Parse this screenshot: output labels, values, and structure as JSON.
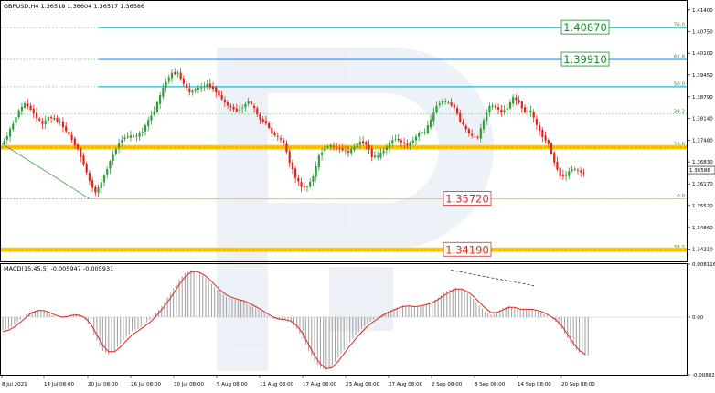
{
  "header": {
    "price_title": "GBPUSD,H4  1.36518 1.36604 1.36517 1.36586",
    "macd_title": "MACD(15,45,5) -0.005947 -0.005931"
  },
  "chart_data": [
    {
      "type": "candlestick",
      "symbol": "GBPUSD",
      "timeframe": "H4",
      "ohlc_last": [
        1.36518,
        1.36604,
        1.36517,
        1.36586
      ],
      "ylim": [
        1.3384,
        1.4167
      ],
      "y_ticks": [
        "1.41400",
        "1.40750",
        "1.40100",
        "1.39450",
        "1.38790",
        "1.38140",
        "1.37480",
        "1.36830",
        "1.36170",
        "1.35520",
        "1.34860",
        "1.34210"
      ],
      "x_ticks": [
        "8 Jul 2021",
        "14 Jul 08:00",
        "20 Jul 08:00",
        "26 Jul 08:00",
        "30 Jul 08:00",
        "5 Aug 08:00",
        "11 Aug 08:00",
        "17 Aug 08:00",
        "23 Aug 08:00",
        "27 Aug 08:00",
        "2 Sep 08:00",
        "8 Sep 08:00",
        "14 Sep 08:00",
        "20 Sep 08:00"
      ],
      "current_price": "1.36586",
      "close_path": [
        1.3735,
        1.3762,
        1.3798,
        1.3838,
        1.3858,
        1.3842,
        1.3816,
        1.3797,
        1.3818,
        1.3812,
        1.3802,
        1.3776,
        1.375,
        1.3721,
        1.3678,
        1.3625,
        1.3591,
        1.3621,
        1.3664,
        1.3705,
        1.3741,
        1.3758,
        1.376,
        1.3761,
        1.3776,
        1.3808,
        1.3837,
        1.3882,
        1.3925,
        1.3949,
        1.395,
        1.3918,
        1.3892,
        1.3902,
        1.3907,
        1.3915,
        1.3904,
        1.3884,
        1.386,
        1.3848,
        1.3836,
        1.3848,
        1.3866,
        1.3843,
        1.381,
        1.38,
        1.3768,
        1.3757,
        1.374,
        1.3683,
        1.3637,
        1.3608,
        1.3608,
        1.3639,
        1.37,
        1.3726,
        1.3733,
        1.3725,
        1.3719,
        1.3712,
        1.3728,
        1.3743,
        1.3737,
        1.37,
        1.3699,
        1.3718,
        1.374,
        1.3753,
        1.3743,
        1.3732,
        1.3748,
        1.377,
        1.3773,
        1.3808,
        1.3853,
        1.3865,
        1.386,
        1.3847,
        1.3806,
        1.378,
        1.376,
        1.3756,
        1.3808,
        1.3852,
        1.3848,
        1.3832,
        1.3845,
        1.3877,
        1.3861,
        1.3833,
        1.3836,
        1.3793,
        1.376,
        1.3737,
        1.3682,
        1.3641,
        1.3643,
        1.3663,
        1.3657,
        1.3648
      ],
      "fibonacci": {
        "levels": [
          {
            "label": "76.0",
            "price": 1.4087
          },
          {
            "label": "61.8",
            "price": 1.3991
          },
          {
            "label": "50.0",
            "price": 1.3909
          },
          {
            "label": "38.2",
            "price": 1.3827
          },
          {
            "label": "23.6",
            "price": 1.3727
          },
          {
            "label": "0.0",
            "price": 1.3572
          },
          {
            "label": "38.2",
            "price": 1.3419
          }
        ]
      },
      "horizontal_lines": [
        {
          "price": 1.4087,
          "color": "#20b2aa",
          "style": "solid"
        },
        {
          "price": 1.3991,
          "color": "#1e90ff",
          "style": "solid"
        },
        {
          "price": 1.3909,
          "color": "#1eb4d2",
          "style": "solid"
        },
        {
          "price": 1.3727,
          "color": "#ffcc00",
          "style": "thick"
        },
        {
          "price": 1.3419,
          "color": "#ffcc00",
          "style": "thick"
        }
      ],
      "price_labels": [
        {
          "text": "1.40870",
          "price": 1.4087,
          "color": "#138d2e"
        },
        {
          "text": "1.39910",
          "price": 1.3991,
          "color": "#138d2e"
        },
        {
          "text": "1.35720",
          "price": 1.3572,
          "color": "#d62d2d"
        },
        {
          "text": "1.34190",
          "price": 1.3419,
          "color": "#d62d2d"
        }
      ],
      "colors": {
        "bull": "#2e9e3c",
        "bear": "#e2231a",
        "fib": "#6fbf73"
      }
    },
    {
      "type": "histogram+line",
      "indicator": "MACD",
      "params": "15,45,5",
      "ylim": [
        -0.008822,
        0.008116
      ],
      "y_ticks": [
        "0.008116",
        "0.00",
        "-0.008822"
      ],
      "histogram": [
        -0.002,
        -0.0018,
        -0.0012,
        -0.0004,
        0.0004,
        0.0009,
        0.0011,
        0.0009,
        0.0005,
        0.0001,
        -0.0001,
        0.0002,
        0.0005,
        0.0003,
        -0.0004,
        -0.0018,
        -0.0036,
        -0.0052,
        -0.0058,
        -0.0052,
        -0.0041,
        -0.003,
        -0.0022,
        -0.0018,
        -0.0012,
        -0.0004,
        0.0006,
        0.0017,
        0.003,
        0.0044,
        0.0058,
        0.0068,
        0.0072,
        0.007,
        0.0064,
        0.0056,
        0.0046,
        0.0037,
        0.0031,
        0.0028,
        0.0026,
        0.0024,
        0.0019,
        0.0014,
        0.0009,
        0.0002,
        -0.0003,
        -0.0004,
        -0.0004,
        -0.0008,
        -0.0018,
        -0.0033,
        -0.0052,
        -0.0068,
        -0.0078,
        -0.0081,
        -0.0074,
        -0.0062,
        -0.005,
        -0.0038,
        -0.0028,
        -0.0018,
        -0.001,
        -0.0004,
        0.0002,
        0.0007,
        0.0011,
        0.0015,
        0.0018,
        0.0017,
        0.0016,
        0.0017,
        0.002,
        0.0024,
        0.003,
        0.0037,
        0.0042,
        0.0045,
        0.0043,
        0.0037,
        0.0028,
        0.0018,
        0.0009,
        0.0004,
        0.0008,
        0.0014,
        0.0017,
        0.0014,
        0.0011,
        0.0013,
        0.0012,
        0.0009,
        0.0005,
        0.0,
        -0.0007,
        -0.0018,
        -0.0032,
        -0.0045,
        -0.0055,
        -0.0059
      ],
      "signal": [
        -0.0022,
        -0.002,
        -0.0015,
        -0.0008,
        0.0,
        0.0007,
        0.001,
        0.001,
        0.0007,
        0.0003,
        0.0,
        0.0001,
        0.0003,
        0.0003,
        -0.0001,
        -0.0011,
        -0.0027,
        -0.0043,
        -0.0053,
        -0.0053,
        -0.0046,
        -0.0036,
        -0.0027,
        -0.0021,
        -0.0015,
        -0.0008,
        0.0001,
        0.0011,
        0.0023,
        0.0036,
        0.005,
        0.0062,
        0.0069,
        0.007,
        0.0066,
        0.0059,
        0.005,
        0.0041,
        0.0034,
        0.003,
        0.0027,
        0.0025,
        0.0021,
        0.0016,
        0.0011,
        0.0005,
        0.0,
        -0.0003,
        -0.0004,
        -0.0006,
        -0.0013,
        -0.0025,
        -0.0042,
        -0.0059,
        -0.0072,
        -0.0079,
        -0.0077,
        -0.0068,
        -0.0056,
        -0.0044,
        -0.0033,
        -0.0023,
        -0.0014,
        -0.0007,
        -0.0001,
        0.0005,
        0.0009,
        0.0013,
        0.0016,
        0.0017,
        0.0016,
        0.0017,
        0.0019,
        0.0022,
        0.0027,
        0.0033,
        0.0039,
        0.0043,
        0.0043,
        0.0039,
        0.0032,
        0.0023,
        0.0014,
        0.0007,
        0.0007,
        0.0011,
        0.0015,
        0.0015,
        0.0012,
        0.0012,
        0.0012,
        0.001,
        0.0007,
        0.0002,
        -0.0004,
        -0.0013,
        -0.0026,
        -0.004,
        -0.0051,
        -0.0057
      ],
      "colors": {
        "histogram": "#a6a6a6",
        "signal": "#e2231a"
      }
    }
  ]
}
